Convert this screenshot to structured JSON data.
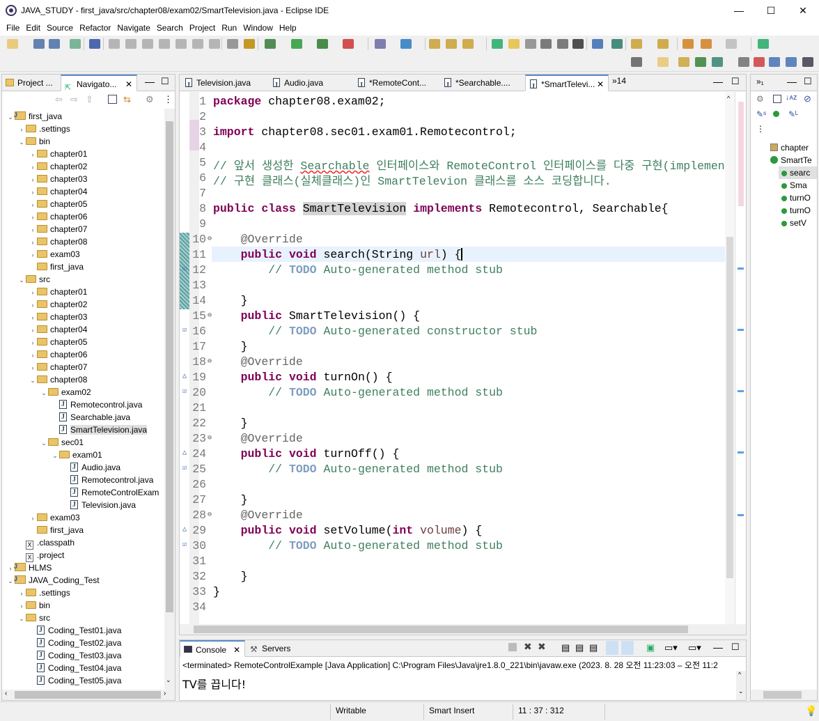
{
  "window": {
    "title": "JAVA_STUDY - first_java/src/chapter08/exam02/SmartTelevision.java - Eclipse IDE",
    "minimize": "—",
    "maximize": "☐",
    "close": "✕"
  },
  "menu": [
    "File",
    "Edit",
    "Source",
    "Refactor",
    "Navigate",
    "Search",
    "Project",
    "Run",
    "Window",
    "Help"
  ],
  "explorer": {
    "tab_project": "Project ...",
    "tab_navigator": "Navigato...",
    "rows": [
      {
        "depth": 0,
        "arrow": "⌄",
        "icon": "project",
        "label": "first_java"
      },
      {
        "depth": 1,
        "arrow": "›",
        "icon": "folder",
        "label": ".settings"
      },
      {
        "depth": 1,
        "arrow": "⌄",
        "icon": "folder",
        "label": "bin"
      },
      {
        "depth": 2,
        "arrow": "›",
        "icon": "folder",
        "label": "chapter01"
      },
      {
        "depth": 2,
        "arrow": "›",
        "icon": "folder",
        "label": "chapter02"
      },
      {
        "depth": 2,
        "arrow": "›",
        "icon": "folder",
        "label": "chapter03"
      },
      {
        "depth": 2,
        "arrow": "›",
        "icon": "folder",
        "label": "chapter04"
      },
      {
        "depth": 2,
        "arrow": "›",
        "icon": "folder",
        "label": "chapter05"
      },
      {
        "depth": 2,
        "arrow": "›",
        "icon": "folder",
        "label": "chapter06"
      },
      {
        "depth": 2,
        "arrow": "›",
        "icon": "folder",
        "label": "chapter07"
      },
      {
        "depth": 2,
        "arrow": "›",
        "icon": "folder",
        "label": "chapter08"
      },
      {
        "depth": 2,
        "arrow": "›",
        "icon": "folder",
        "label": "exam03"
      },
      {
        "depth": 2,
        "arrow": "",
        "icon": "folder",
        "label": "first_java"
      },
      {
        "depth": 1,
        "arrow": "⌄",
        "icon": "folder",
        "label": "src"
      },
      {
        "depth": 2,
        "arrow": "›",
        "icon": "folder",
        "label": "chapter01"
      },
      {
        "depth": 2,
        "arrow": "›",
        "icon": "folder",
        "label": "chapter02"
      },
      {
        "depth": 2,
        "arrow": "›",
        "icon": "folder",
        "label": "chapter03"
      },
      {
        "depth": 2,
        "arrow": "›",
        "icon": "folder",
        "label": "chapter04"
      },
      {
        "depth": 2,
        "arrow": "›",
        "icon": "folder",
        "label": "chapter05"
      },
      {
        "depth": 2,
        "arrow": "›",
        "icon": "folder",
        "label": "chapter06"
      },
      {
        "depth": 2,
        "arrow": "›",
        "icon": "folder",
        "label": "chapter07"
      },
      {
        "depth": 2,
        "arrow": "⌄",
        "icon": "folder",
        "label": "chapter08"
      },
      {
        "depth": 3,
        "arrow": "⌄",
        "icon": "folder",
        "label": "exam02"
      },
      {
        "depth": 4,
        "arrow": "",
        "icon": "java",
        "label": "Remotecontrol.java"
      },
      {
        "depth": 4,
        "arrow": "",
        "icon": "java",
        "label": "Searchable.java"
      },
      {
        "depth": 4,
        "arrow": "",
        "icon": "java",
        "label": "SmartTelevision.java",
        "selected": true
      },
      {
        "depth": 3,
        "arrow": "⌄",
        "icon": "folder",
        "label": "sec01"
      },
      {
        "depth": 4,
        "arrow": "⌄",
        "icon": "folder",
        "label": "exam01"
      },
      {
        "depth": 5,
        "arrow": "",
        "icon": "java",
        "label": "Audio.java"
      },
      {
        "depth": 5,
        "arrow": "",
        "icon": "java",
        "label": "Remotecontrol.java"
      },
      {
        "depth": 5,
        "arrow": "",
        "icon": "java",
        "label": "RemoteControlExam"
      },
      {
        "depth": 5,
        "arrow": "",
        "icon": "java",
        "label": "Television.java"
      },
      {
        "depth": 2,
        "arrow": "›",
        "icon": "folder",
        "label": "exam03"
      },
      {
        "depth": 2,
        "arrow": "",
        "icon": "folder",
        "label": "first_java"
      },
      {
        "depth": 1,
        "arrow": "",
        "icon": "x",
        "label": ".classpath"
      },
      {
        "depth": 1,
        "arrow": "",
        "icon": "x",
        "label": ".project"
      },
      {
        "depth": 0,
        "arrow": "›",
        "icon": "project",
        "label": "HLMS"
      },
      {
        "depth": 0,
        "arrow": "⌄",
        "icon": "project",
        "label": "JAVA_Coding_Test"
      },
      {
        "depth": 1,
        "arrow": "›",
        "icon": "folder",
        "label": ".settings"
      },
      {
        "depth": 1,
        "arrow": "›",
        "icon": "folder",
        "label": "bin"
      },
      {
        "depth": 1,
        "arrow": "⌄",
        "icon": "folder",
        "label": "src"
      },
      {
        "depth": 2,
        "arrow": "",
        "icon": "java",
        "label": "Coding_Test01.java"
      },
      {
        "depth": 2,
        "arrow": "",
        "icon": "java",
        "label": "Coding_Test02.java"
      },
      {
        "depth": 2,
        "arrow": "",
        "icon": "java",
        "label": "Coding_Test03.java"
      },
      {
        "depth": 2,
        "arrow": "",
        "icon": "java",
        "label": "Coding_Test04.java"
      },
      {
        "depth": 2,
        "arrow": "",
        "icon": "java",
        "label": "Coding_Test05.java"
      }
    ]
  },
  "editor_tabs": [
    {
      "label": "Television.java",
      "active": false
    },
    {
      "label": "Audio.java",
      "active": false
    },
    {
      "label": "*RemoteCont...",
      "active": false
    },
    {
      "label": "*Searchable....",
      "active": false
    },
    {
      "label": "*SmartTelevi...",
      "active": true
    }
  ],
  "editor_tab_overflow": "»14",
  "code_lines": [
    {
      "n": "1",
      "html": "<span class='kw'>package</span> chapter08.exam02;"
    },
    {
      "n": "2",
      "html": ""
    },
    {
      "n": "3",
      "html": "<span class='kw'>import</span> chapter08.sec01.exam01.Remotecontrol;"
    },
    {
      "n": "4",
      "html": ""
    },
    {
      "n": "5",
      "html": "<span class='cm'>// 앞서 생성한 <span class='squig'>Searchable</span> 인터페이스와 RemoteControl 인터페이스를 다중 구현(implements)</span>"
    },
    {
      "n": "6",
      "html": "<span class='cm'>// 구현 클래스(실체클래스)인 SmartTelevion 클래스를 소스 코딩합니다.</span>"
    },
    {
      "n": "7",
      "html": ""
    },
    {
      "n": "8",
      "html": "<span class='kw'>public</span> <span class='kw'>class</span> <span class='hl'>SmartTelevision</span> <span class='kw'>implements</span> Remotecontrol, Searchable{"
    },
    {
      "n": "9",
      "html": ""
    },
    {
      "n": "10",
      "html": "    <span class='an'>@Override</span>"
    },
    {
      "n": "11",
      "html": "    <span class='kw'>public</span> <span class='kw'>void</span> search(String <span class='pv'>url</span>) {"
    },
    {
      "n": "12",
      "html": "        <span class='cm'>// <span class='td'>TODO</span> Auto-generated method stub</span>"
    },
    {
      "n": "13",
      "html": ""
    },
    {
      "n": "14",
      "html": "    }"
    },
    {
      "n": "15",
      "html": "    <span class='kw'>public</span> SmartTelevision() {"
    },
    {
      "n": "16",
      "html": "        <span class='cm'>// <span class='td'>TODO</span> Auto-generated constructor stub</span>"
    },
    {
      "n": "17",
      "html": "    }"
    },
    {
      "n": "18",
      "html": "    <span class='an'>@Override</span>"
    },
    {
      "n": "19",
      "html": "    <span class='kw'>public</span> <span class='kw'>void</span> turnOn() {"
    },
    {
      "n": "20",
      "html": "        <span class='cm'>// <span class='td'>TODO</span> Auto-generated method stub</span>"
    },
    {
      "n": "21",
      "html": ""
    },
    {
      "n": "22",
      "html": "    }"
    },
    {
      "n": "23",
      "html": "    <span class='an'>@Override</span>"
    },
    {
      "n": "24",
      "html": "    <span class='kw'>public</span> <span class='kw'>void</span> turnOff() {"
    },
    {
      "n": "25",
      "html": "        <span class='cm'>// <span class='td'>TODO</span> Auto-generated method stub</span>"
    },
    {
      "n": "26",
      "html": ""
    },
    {
      "n": "27",
      "html": "    }"
    },
    {
      "n": "28",
      "html": "    <span class='an'>@Override</span>"
    },
    {
      "n": "29",
      "html": "    <span class='kw'>public</span> <span class='kw'>void</span> setVolume(<span class='kw'>int</span> <span class='pv'>volume</span>) {"
    },
    {
      "n": "30",
      "html": "        <span class='cm'>// <span class='td'>TODO</span> Auto-generated method stub</span>"
    },
    {
      "n": "31",
      "html": ""
    },
    {
      "n": "32",
      "html": "    }"
    },
    {
      "n": "33",
      "html": "}"
    },
    {
      "n": "34",
      "html": ""
    }
  ],
  "outline": {
    "items": [
      {
        "label": "chapter",
        "icon": "package",
        "depth": 0
      },
      {
        "label": "SmartTe",
        "icon": "class",
        "depth": 0
      },
      {
        "label": "searc",
        "icon": "method",
        "depth": 1,
        "selected": true
      },
      {
        "label": "Sma",
        "icon": "ctor",
        "depth": 1
      },
      {
        "label": "turnO",
        "icon": "method",
        "depth": 1
      },
      {
        "label": "turnO",
        "icon": "method",
        "depth": 1
      },
      {
        "label": "setV",
        "icon": "method",
        "depth": 1
      }
    ]
  },
  "console": {
    "tab_console": "Console",
    "tab_servers": "Servers",
    "header": "<terminated> RemoteControlExample [Java Application] C:\\Program Files\\Java\\jre1.8.0_221\\bin\\javaw.exe  (2023. 8. 28 오전 11:23:03 – 오전 11:2",
    "output": "TV를 끕니다!"
  },
  "status": {
    "writable": "Writable",
    "insert_mode": "Smart Insert",
    "position": "11 : 37 : 312"
  },
  "colors": {
    "keyword": "#7f0055",
    "comment": "#3f7f5f",
    "todo": "#7f9fbf",
    "active_tab_border": "#5a8ac6"
  }
}
